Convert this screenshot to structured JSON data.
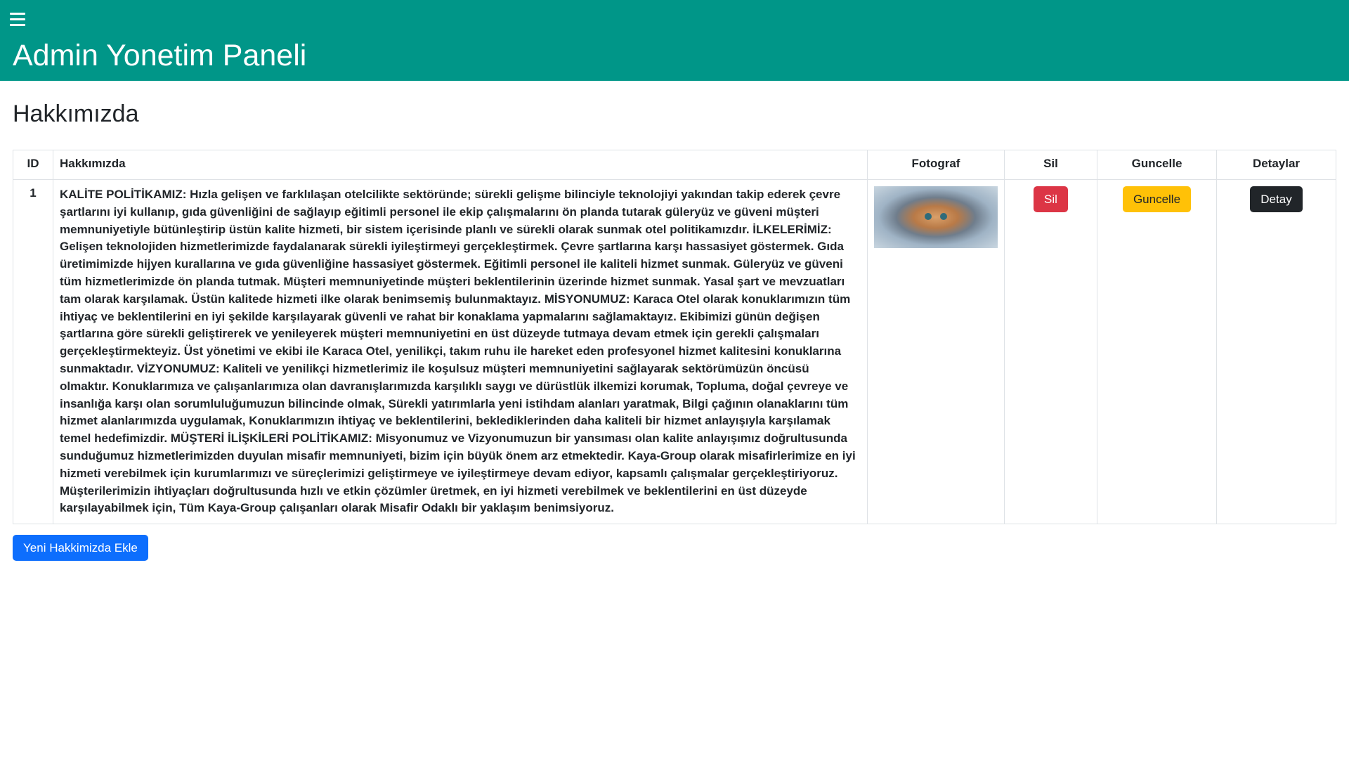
{
  "header": {
    "menu_icon": "hamburger-menu-icon",
    "title": "Admin Yonetim Paneli",
    "bg_color": "#009688"
  },
  "page": {
    "title": "Hakkımızda"
  },
  "table": {
    "headers": [
      "ID",
      "Hakkımızda",
      "Fotograf",
      "Sil",
      "Guncelle",
      "Detaylar"
    ],
    "rows": [
      {
        "id": "1",
        "about": "KALİTE POLİTİKAMIZ: Hızla gelişen ve farklılaşan otelcilikte sektöründe; sürekli gelişme bilinciyle teknolojiyi yakından takip ederek çevre şartlarını iyi kullanıp, gıda güvenliğini de sağlayıp eğitimli personel ile ekip çalışmalarını ön planda tutarak güleryüz ve güveni müşteri memnuniyetiyle bütünleştirip üstün kalite hizmeti, bir sistem içerisinde planlı ve sürekli olarak sunmak otel politikamızdır. İLKELERİMİZ: Gelişen teknolojiden hizmetlerimizde faydalanarak sürekli iyileştirmeyi gerçekleştirmek. Çevre şartlarına karşı hassasiyet göstermek. Gıda üretimimizde hijyen kurallarına ve gıda güvenliğine hassasiyet göstermek. Eğitimli personel ile kaliteli hizmet sunmak. Güleryüz ve güveni tüm hizmetlerimizde ön planda tutmak. Müşteri memnuniyetinde müşteri beklentilerinin üzerinde hizmet sunmak. Yasal şart ve mevzuatları tam olarak karşılamak. Üstün kalitede hizmeti ilke olarak benimsemiş bulunmaktayız. MİSYONUMUZ: Karaca Otel olarak konuklarımızın tüm ihtiyaç ve beklentilerini en iyi şekilde karşılayarak güvenli ve rahat bir konaklama yapmalarını sağlamaktayız. Ekibimizi günün değişen şartlarına göre sürekli geliştirerek ve yenileyerek müşteri memnuniyetini en üst düzeyde tutmaya devam etmek için gerekli çalışmaları gerçekleştirmekteyiz. Üst yönetimi ve ekibi ile Karaca Otel, yenilikçi, takım ruhu ile hareket eden profesyonel hizmet kalitesini konuklarına sunmaktadır. VİZYONUMUZ: Kaliteli ve yenilikçi hizmetlerimiz ile koşulsuz müşteri memnuniyetini sağlayarak sektörümüzün öncüsü olmaktır. Konuklarımıza ve çalışanlarımıza olan davranışlarımızda karşılıklı saygı ve dürüstlük ilkemizi korumak, Topluma, doğal çevreye ve insanlığa karşı olan sorumluluğumuzun bilincinde olmak, Sürekli yatırımlarla yeni istihdam alanları yaratmak, Bilgi çağının olanaklarını tüm hizmet alanlarımızda uygulamak, Konuklarımızın ihtiyaç ve beklentilerini, beklediklerinden daha kaliteli bir hizmet anlayışıyla karşılamak temel hedefimizdir. MÜŞTERİ İLİŞKİLERİ POLİTİKAMIZ: Misyonumuz ve Vizyonumuzun bir yansıması olan kalite anlayışımız doğrultusunda sunduğumuz hizmetlerimizden duyulan misafir memnuniyeti, bizim için büyük önem arz etmektedir. Kaya-Group olarak misafirlerimize en iyi hizmeti verebilmek için kurumlarımızı ve süreçlerimizi geliştirmeye ve iyileştirmeye devam ediyor, kapsamlı çalışmalar gerçekleştiriyoruz. Müşterilerimizin ihtiyaçları doğrultusunda hızlı ve etkin çözümler üretmek, en iyi hizmeti verebilmek ve beklentilerini en üst düzeyde karşılayabilmek için, Tüm Kaya-Group çalışanları olarak Misafir Odaklı bir yaklaşım benimsiyoruz.",
        "photo": "kitten-photo",
        "delete_label": "Sil",
        "update_label": "Guncelle",
        "detail_label": "Detay"
      }
    ]
  },
  "actions": {
    "add_label": "Yeni Hakkimizda Ekle"
  },
  "colors": {
    "danger": "#dc3545",
    "warning": "#ffc107",
    "dark": "#212529",
    "primary": "#0d6efd"
  }
}
